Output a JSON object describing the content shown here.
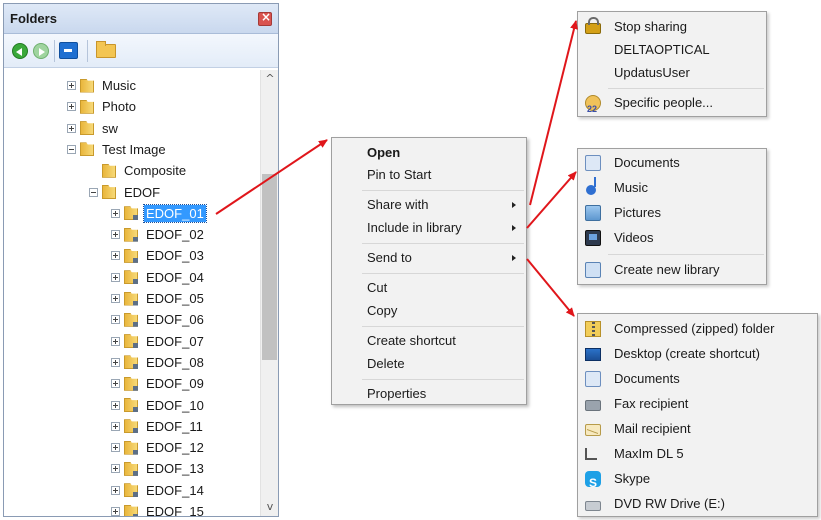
{
  "folders_panel": {
    "title": "Folders",
    "close_glyph": "×",
    "toolbar_icons": [
      "back-arrow-icon",
      "forward-arrow-icon",
      "view-icon",
      "open-folder-icon"
    ],
    "scroll_up_glyph": "^",
    "scroll_down_glyph": "v",
    "tree": [
      {
        "label": "Music",
        "expander": "plus"
      },
      {
        "label": "Photo",
        "expander": "plus"
      },
      {
        "label": "sw",
        "expander": "plus"
      },
      {
        "label": "Test Image",
        "expander": "minus"
      },
      {
        "label": "Composite",
        "expander": "none"
      },
      {
        "label": "EDOF",
        "expander": "minus"
      },
      {
        "label": "EDOF_01",
        "expander": "plus",
        "selected": true
      },
      {
        "label": "EDOF_02",
        "expander": "plus"
      },
      {
        "label": "EDOF_03",
        "expander": "plus"
      },
      {
        "label": "EDOF_04",
        "expander": "plus"
      },
      {
        "label": "EDOF_05",
        "expander": "plus"
      },
      {
        "label": "EDOF_06",
        "expander": "plus"
      },
      {
        "label": "EDOF_07",
        "expander": "plus"
      },
      {
        "label": "EDOF_08",
        "expander": "plus"
      },
      {
        "label": "EDOF_09",
        "expander": "plus"
      },
      {
        "label": "EDOF_10",
        "expander": "plus"
      },
      {
        "label": "EDOF_11",
        "expander": "plus"
      },
      {
        "label": "EDOF_12",
        "expander": "plus"
      },
      {
        "label": "EDOF_13",
        "expander": "plus"
      },
      {
        "label": "EDOF_14",
        "expander": "plus"
      },
      {
        "label": "EDOF_15",
        "expander": "plus"
      }
    ]
  },
  "context_menu": {
    "open": "Open",
    "pin_to_start": "Pin to Start",
    "share_with": "Share with",
    "include_in_library": "Include in library",
    "send_to": "Send to",
    "cut": "Cut",
    "copy": "Copy",
    "create_shortcut": "Create shortcut",
    "delete": "Delete",
    "properties": "Properties"
  },
  "share_submenu": {
    "items": [
      {
        "label": "Stop sharing",
        "icon": "lock-icon"
      },
      {
        "label": "DELTAOPTICAL",
        "icon": ""
      },
      {
        "label": "UpdatusUser",
        "icon": ""
      },
      {
        "label": "Specific people...",
        "icon": "people-icon"
      }
    ]
  },
  "library_submenu": {
    "items": [
      {
        "label": "Documents",
        "icon": "documents-icon"
      },
      {
        "label": "Music",
        "icon": "music-icon"
      },
      {
        "label": "Pictures",
        "icon": "pictures-icon"
      },
      {
        "label": "Videos",
        "icon": "videos-icon"
      },
      {
        "label": "Create new library",
        "icon": "new-library-icon"
      }
    ]
  },
  "sendto_submenu": {
    "items": [
      {
        "label": "Compressed (zipped) folder",
        "icon": "zip-folder-icon"
      },
      {
        "label": "Desktop (create shortcut)",
        "icon": "desktop-icon"
      },
      {
        "label": "Documents",
        "icon": "documents-icon"
      },
      {
        "label": "Fax recipient",
        "icon": "fax-icon"
      },
      {
        "label": "Mail recipient",
        "icon": "mail-icon"
      },
      {
        "label": "MaxIm DL 5",
        "icon": "maxim-icon"
      },
      {
        "label": "Skype",
        "icon": "skype-icon"
      },
      {
        "label": "DVD RW Drive (E:)",
        "icon": "dvd-drive-icon"
      }
    ]
  },
  "colors": {
    "selection": "#3399ff",
    "arrow": "#e0161b",
    "menu_bg": "#f2f2f2"
  }
}
